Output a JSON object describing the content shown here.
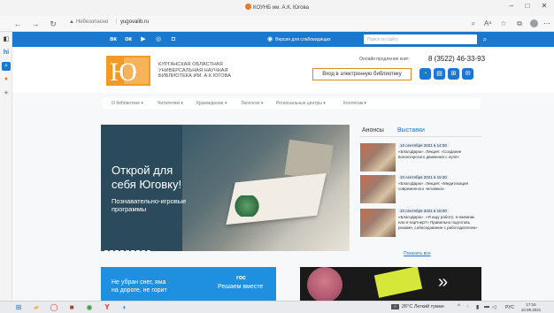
{
  "browser": {
    "tab_title": "КОУНБ им. А.К. Югова",
    "window_controls": [
      "–",
      "□",
      "✕"
    ],
    "address": {
      "security_label": "Небезопасно",
      "url": "yugovalib.ru"
    }
  },
  "site": {
    "topbar": {
      "social": [
        {
          "name": "vk",
          "glyph": "вк"
        },
        {
          "name": "odnoklassniki",
          "glyph": "ок"
        },
        {
          "name": "youtube",
          "glyph": "▶"
        },
        {
          "name": "instagram",
          "glyph": "◎"
        },
        {
          "name": "telegram",
          "glyph": "◘"
        }
      ],
      "vision_version": "Версия для слабовидящих",
      "search_placeholder": "Поиск по сайту",
      "search_icon": "search-icon"
    },
    "header": {
      "logo_letters": "Ю",
      "library_name_line1": "Курганская областная",
      "library_name_line2": "универсальная научная",
      "library_name_line3": "библиотека им. А.К.Югова",
      "hotline_label": "Онлайн продление книг:",
      "phone": "8 (3522) 46-33-93",
      "login_button": "Вход в электронную библиотеку"
    },
    "menu": [
      "О библиотеке ▾",
      "Читателям ▾",
      "Краеведение ▾",
      "Экология ▾",
      "Региональные центры ▾",
      "Коллегам ▾"
    ],
    "slider": {
      "headline_line1": "Открой для",
      "headline_line2": "себя Юговку!",
      "sub_line1": "Познавательно-игровые",
      "sub_line2": "программы",
      "total_slides": 9,
      "active_index": 6
    },
    "news": {
      "tabs": [
        "Анонсы",
        "Выставки"
      ],
      "active_tab": 0,
      "items": [
        {
          "date": "10 сентября 2021 в 14:00",
          "text": "«БлагоДарю». Лекция: «Создание волонтерского движения с нуля»"
        },
        {
          "date": "10 сентября 2021 в 15:30",
          "text": "«БлагоДарю». Лекция: «Медитизация современного человека»"
        },
        {
          "date": "10 сентября 2021 в 18:00",
          "text": "«БлагоДарю». «Я ищу работу: я-наемник или я-партнер?» Правильно подготовь резюме, собеседование с работодателем»"
        }
      ],
      "show_all": "Показать все"
    },
    "banners": {
      "left_line1": "Не убран снег, яма",
      "left_line2": "на дороге, не горит",
      "gos_brand": "гос",
      "gos_tagline": "Решаем вместе"
    }
  },
  "taskbar": {
    "weather": "26°C Легкий туман",
    "lang": "РУС",
    "time": "17:16",
    "date": "10.09.2021"
  }
}
